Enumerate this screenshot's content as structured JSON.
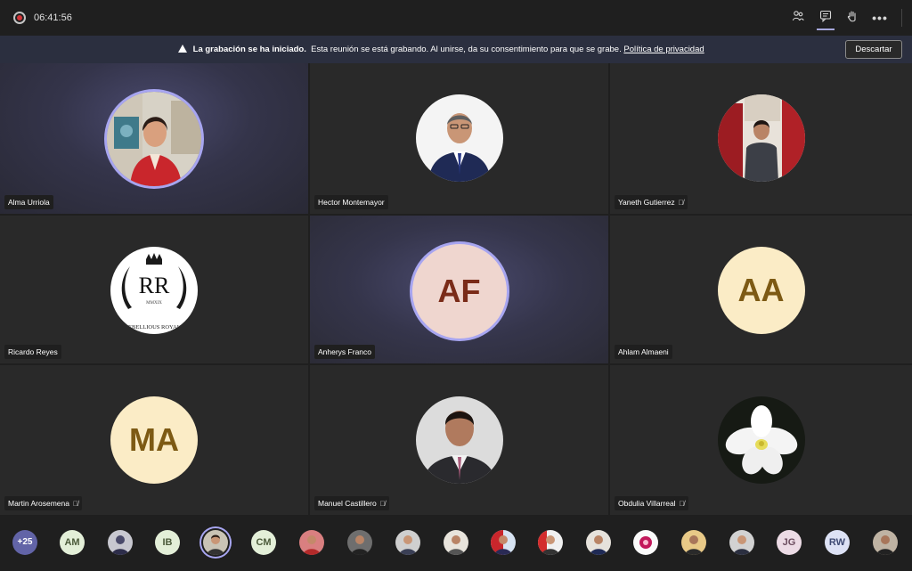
{
  "topbar": {
    "timer": "06:41:56",
    "icons": [
      "participants-icon",
      "chat-icon",
      "raise-hand-icon",
      "more-options-icon"
    ]
  },
  "banner": {
    "title": "La grabación se ha iniciado.",
    "message": "Esta reunión se está grabando. Al unirse, da su consentimiento para que se grabe.",
    "link": "Política de privacidad",
    "dismiss": "Descartar"
  },
  "tiles": [
    {
      "name": "Alma Urriola",
      "type": "photo",
      "muted": false,
      "speaking": true
    },
    {
      "name": "Hector Montemayor",
      "type": "photo",
      "muted": false
    },
    {
      "name": "Yaneth Gutierrez",
      "type": "photo",
      "muted": true
    },
    {
      "name": "Ricardo Reyes",
      "type": "logo",
      "muted": false,
      "logo_text": "RR",
      "logo_sub": "MMXIX",
      "logo_caption": "REBELLIOUS ROYALS"
    },
    {
      "name": "Anherys Franco",
      "type": "initials",
      "initials": "AF",
      "muted": false,
      "speaking": true
    },
    {
      "name": "Ahlam Almaeni",
      "type": "initials",
      "initials": "AA",
      "muted": false
    },
    {
      "name": "Martin Arosemena",
      "type": "initials",
      "initials": "MA",
      "muted": true
    },
    {
      "name": "Manuel Castillero",
      "type": "photo",
      "muted": true
    },
    {
      "name": "Obdulia Villarreal",
      "type": "photo",
      "muted": true
    }
  ],
  "strip": {
    "more_count": "+25",
    "initials": [
      "AM",
      "IB",
      "CM",
      "JG",
      "RW"
    ]
  },
  "colors": {
    "accent": "#6264a7",
    "ring": "#a7a5f0",
    "tile": "#292929",
    "banner": "#2b2f3f",
    "record": "#d13438"
  }
}
